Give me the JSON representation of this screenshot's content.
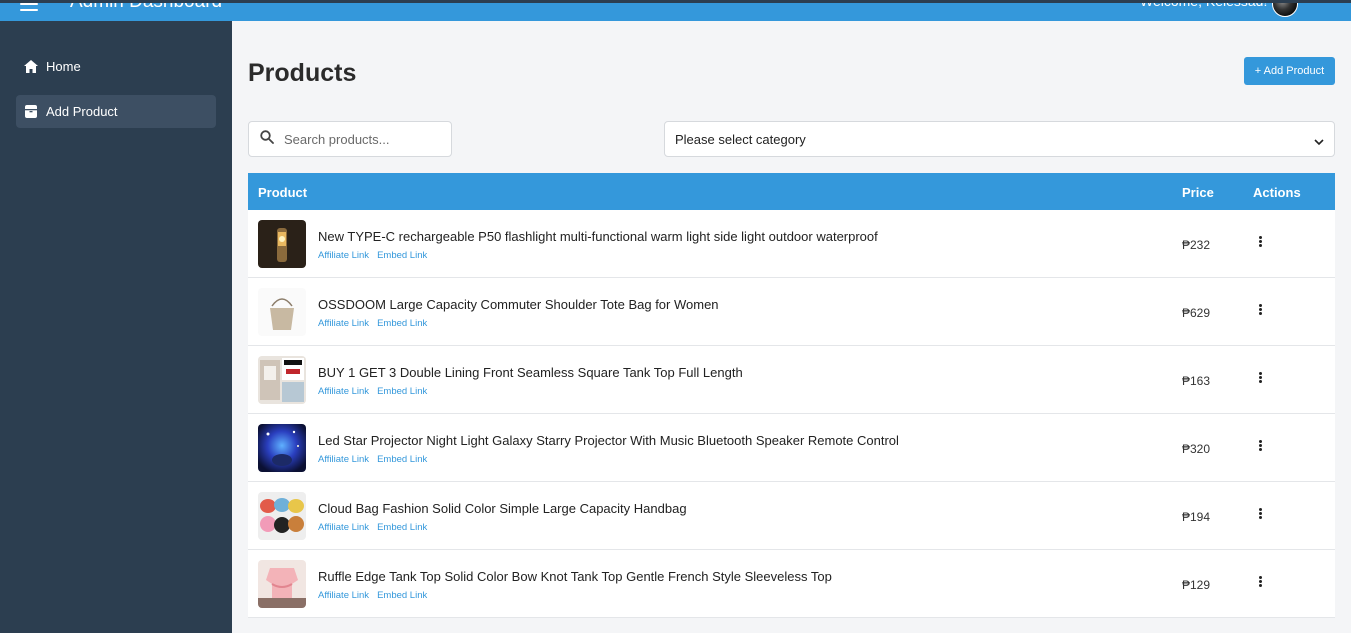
{
  "header": {
    "title": "Admin Dashboard",
    "welcome": "Welcome, Kelessad!"
  },
  "sidebar": {
    "items": [
      {
        "label": "Home",
        "icon": "home-icon",
        "active": false
      },
      {
        "label": "Add Product",
        "icon": "box-icon",
        "active": true
      }
    ]
  },
  "page": {
    "title": "Products",
    "add_button": "+ Add Product",
    "search_placeholder": "Search products...",
    "category_value": "Please select category"
  },
  "table": {
    "columns": {
      "product": "Product",
      "price": "Price",
      "actions": "Actions"
    },
    "link_labels": {
      "affiliate": "Affiliate Link",
      "embed": "Embed Link"
    },
    "rows": [
      {
        "name": "New TYPE-C rechargeable P50 flashlight multi-functional warm light side light outdoor waterproof",
        "price": "₱232",
        "thumb": "flashlight"
      },
      {
        "name": "OSSDOOM Large Capacity Commuter Shoulder Tote Bag for Women",
        "price": "₱629",
        "thumb": "tote-bag"
      },
      {
        "name": "BUY 1 GET 3 Double Lining Front Seamless Square Tank Top Full Length",
        "price": "₱163",
        "thumb": "tank-top"
      },
      {
        "name": "Led Star Projector Night Light Galaxy Starry Projector With Music Bluetooth Speaker Remote Control",
        "price": "₱320",
        "thumb": "projector"
      },
      {
        "name": "Cloud Bag Fashion Solid Color Simple Large Capacity Handbag",
        "price": "₱194",
        "thumb": "handbags"
      },
      {
        "name": "Ruffle Edge Tank Top Solid Color Bow Knot Tank Top Gentle French Style Sleeveless Top",
        "price": "₱129",
        "thumb": "ruffle-top"
      }
    ]
  },
  "colors": {
    "accent": "#3498db",
    "sidebar": "#2c3e50",
    "sidebar_active": "#3d4f63",
    "background": "#f4f5f7"
  }
}
